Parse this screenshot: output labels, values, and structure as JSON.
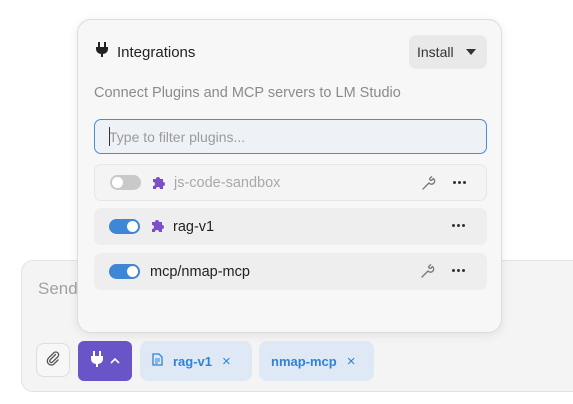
{
  "composer": {
    "placeholder": "Send",
    "chips": [
      {
        "label": "rag-v1",
        "remove": "×"
      },
      {
        "label": "nmap-mcp",
        "remove": "×"
      }
    ]
  },
  "popover": {
    "title": "Integrations",
    "install_label": "Install",
    "subtitle": "Connect Plugins and MCP servers to LM Studio",
    "filter_placeholder": "Type to filter plugins...",
    "plugins": [
      {
        "name": "js-code-sandbox",
        "enabled": false,
        "icon": "puzzle-icon",
        "has_settings": true
      },
      {
        "name": "rag-v1",
        "enabled": true,
        "icon": "puzzle-icon",
        "has_settings": false
      },
      {
        "name": "mcp/nmap-mcp",
        "enabled": true,
        "icon": "",
        "has_settings": true
      }
    ]
  },
  "colors": {
    "accent_purple": "#6a55c8",
    "toggle_on": "#3f86d6",
    "chip_bg": "#dfe9f6",
    "chip_text": "#2f83d6",
    "plugin_icon": "#7b4fc9"
  }
}
